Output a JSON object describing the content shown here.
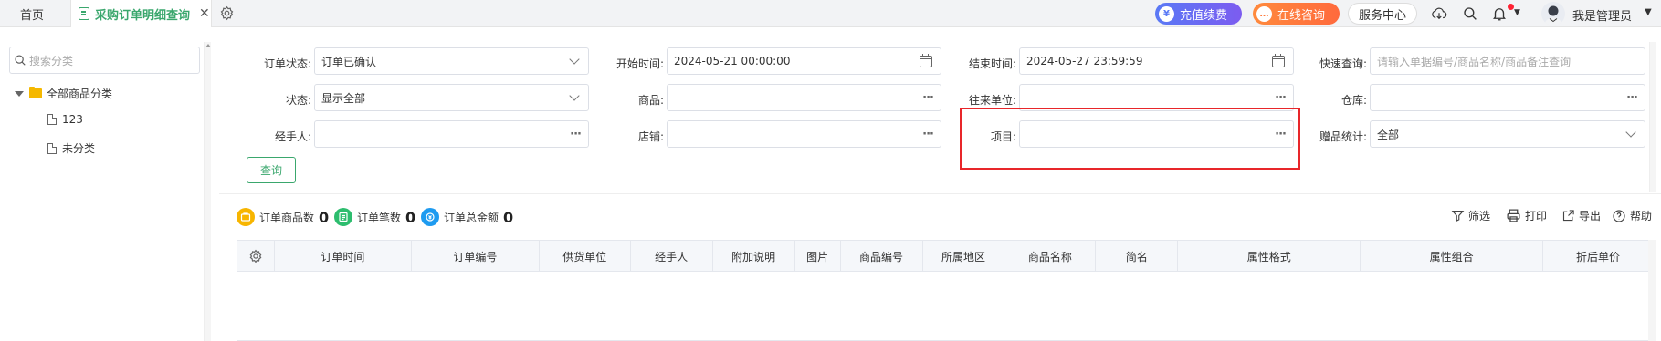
{
  "tabs": {
    "home": "首页",
    "active": "采购订单明细查询",
    "close": "✕"
  },
  "header": {
    "recharge": "充值续费",
    "consult": "在线咨询",
    "service": "服务中心",
    "user": "我是管理员"
  },
  "sidebar": {
    "search_placeholder": "搜索分类",
    "root": "全部商品分类",
    "children": [
      "123",
      "未分类"
    ]
  },
  "filters": {
    "order_status": {
      "label": "订单状态:",
      "value": "订单已确认"
    },
    "start_time": {
      "label": "开始时间:",
      "value": "2024-05-21 00:00:00"
    },
    "end_time": {
      "label": "结束时间:",
      "value": "2024-05-27 23:59:59"
    },
    "quick_query": {
      "label": "快速查询:",
      "placeholder": "请输入单据编号/商品名称/商品备注查询"
    },
    "status": {
      "label": "状态:",
      "value": "显示全部"
    },
    "product": {
      "label": "商品:",
      "value": ""
    },
    "partner": {
      "label": "往来单位:",
      "value": ""
    },
    "warehouse": {
      "label": "仓库:",
      "value": ""
    },
    "handler": {
      "label": "经手人:",
      "value": ""
    },
    "store": {
      "label": "店铺:",
      "value": ""
    },
    "project": {
      "label": "项目:",
      "value": ""
    },
    "gift_stats": {
      "label": "赠品统计:",
      "value": "全部"
    },
    "query_button": "查询"
  },
  "stats": [
    {
      "label": "订单商品数",
      "value": "0"
    },
    {
      "label": "订单笔数",
      "value": "0"
    },
    {
      "label": "订单总金额",
      "value": "0"
    }
  ],
  "toolbar": {
    "filter": "筛选",
    "print": "打印",
    "export": "导出",
    "help": "帮助"
  },
  "table": {
    "columns": [
      "订单时间",
      "订单编号",
      "供货单位",
      "经手人",
      "附加说明",
      "图片",
      "商品编号",
      "所属地区",
      "商品名称",
      "简名",
      "属性格式",
      "属性组合",
      "折后单价"
    ],
    "rows": []
  },
  "colors": {
    "accent": "#3aa76d",
    "highlight": "#e8262a",
    "recharge": "#5a79f5",
    "consult": "#ff7a3d"
  }
}
